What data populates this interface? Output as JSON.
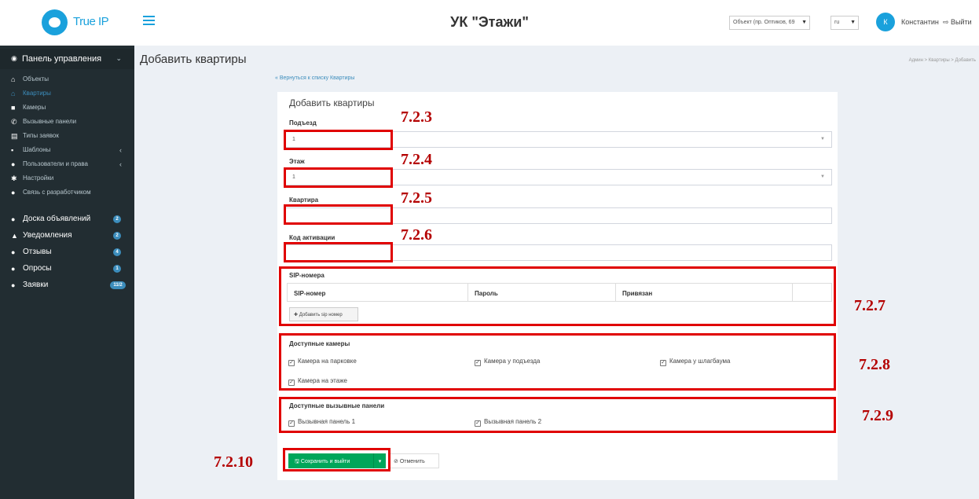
{
  "header": {
    "logo_text": "True IP",
    "app_title": "УК \"Этажи\"",
    "object_select": "Объект (пр. Оптиков, 69",
    "lang_select": "ru",
    "avatar_letter": "К",
    "username": "Константин",
    "logout": "Выйти"
  },
  "sidebar": {
    "panel": "Панель управления",
    "items": [
      {
        "label": "Объекты",
        "icon": "home-icon"
      },
      {
        "label": "Квартиры",
        "icon": "apartment-icon"
      },
      {
        "label": "Камеры",
        "icon": "camera-icon"
      },
      {
        "label": "Вызывные панели",
        "icon": "phone-icon"
      },
      {
        "label": "Типы заявок",
        "icon": "list-icon"
      },
      {
        "label": "Шаблоны",
        "icon": "template-icon"
      },
      {
        "label": "Пользователи и права",
        "icon": "users-icon"
      },
      {
        "label": "Настройки",
        "icon": "gear-icon"
      },
      {
        "label": "Связь с разработчиком",
        "icon": "chat-icon"
      }
    ],
    "big_items": [
      {
        "label": "Доска объявлений",
        "badge": "2"
      },
      {
        "label": "Уведомления",
        "badge": "2"
      },
      {
        "label": "Отзывы",
        "badge": "4"
      },
      {
        "label": "Опросы",
        "badge": "1"
      },
      {
        "label": "Заявки",
        "badge": "11/2"
      }
    ]
  },
  "content": {
    "title": "Добавить квартиры",
    "breadcrumb": "Админ  >  Квартиры  >  Добавить",
    "back_link": "« Вернуться к списку Квартиры",
    "box_title": "Добавить квартиры",
    "fields": {
      "entrance_label": "Подъезд",
      "entrance_value": "1",
      "floor_label": "Этаж",
      "floor_value": "1",
      "apartment_label": "Квартира",
      "activation_label": "Код активации"
    },
    "sip": {
      "title": "SIP-номера",
      "columns": [
        "SIP-номер",
        "Пароль",
        "Привязан"
      ],
      "add_button": "Добавить sip номер"
    },
    "cameras": {
      "title": "Доступные камеры",
      "items": [
        "Камера на парковке",
        "Камера у подъезда",
        "Камера у шлагбаума",
        "Камера на этаже"
      ]
    },
    "panels": {
      "title": "Доступные вызывные панели",
      "items": [
        "Вызывная панель 1",
        "Вызывная панель 2"
      ]
    },
    "save_button": "Сохранить и выйти",
    "cancel_button": "Отменить"
  },
  "annotations": [
    "7.2.3",
    "7.2.4",
    "7.2.5",
    "7.2.6",
    "7.2.7",
    "7.2.8",
    "7.2.9",
    "7.2.10"
  ],
  "colors": {
    "accent": "#1aa1dc",
    "sidebar": "#222d32",
    "save": "#00a65a",
    "annotation": "#e00000"
  }
}
